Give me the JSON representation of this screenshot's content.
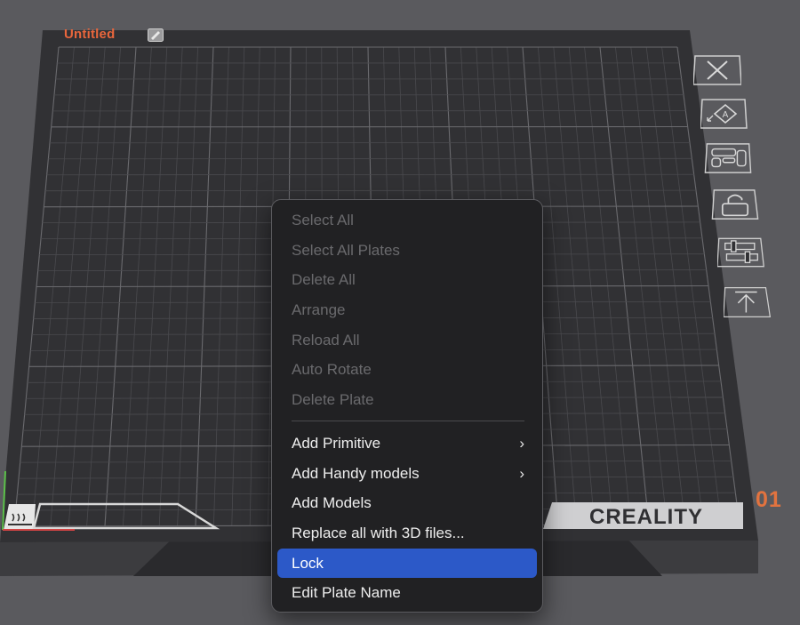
{
  "plate": {
    "name": "Untitled",
    "number": "01",
    "brand": "CREALITY"
  },
  "side_toolbar": [
    {
      "icon": "close-icon"
    },
    {
      "icon": "auto-orient-icon"
    },
    {
      "icon": "arrange-icon"
    },
    {
      "icon": "lock-icon"
    },
    {
      "icon": "plate-settings-icon"
    },
    {
      "icon": "move-to-top-icon"
    }
  ],
  "context_menu": {
    "group_disabled": [
      {
        "label": "Select All",
        "enabled": false
      },
      {
        "label": "Select All Plates",
        "enabled": false
      },
      {
        "label": "Delete All",
        "enabled": false
      },
      {
        "label": "Arrange",
        "enabled": false
      },
      {
        "label": "Reload All",
        "enabled": false
      },
      {
        "label": "Auto Rotate",
        "enabled": false
      },
      {
        "label": "Delete Plate",
        "enabled": false
      }
    ],
    "group_enabled": [
      {
        "label": "Add Primitive",
        "submenu": true,
        "submenu_glyph": "›"
      },
      {
        "label": "Add Handy models",
        "submenu": true,
        "submenu_glyph": "›"
      },
      {
        "label": "Add Models",
        "submenu": false
      },
      {
        "label": "Replace all with 3D files...",
        "submenu": false
      },
      {
        "label": "Lock",
        "submenu": false,
        "highlighted": true
      },
      {
        "label": "Edit Plate Name",
        "submenu": false
      }
    ]
  },
  "colors": {
    "accent_orange": "#e8663c",
    "menu_highlight": "#2c59c8",
    "menu_bg": "#212123",
    "bed_surface": "#303033",
    "background": "#5a5a5e"
  }
}
